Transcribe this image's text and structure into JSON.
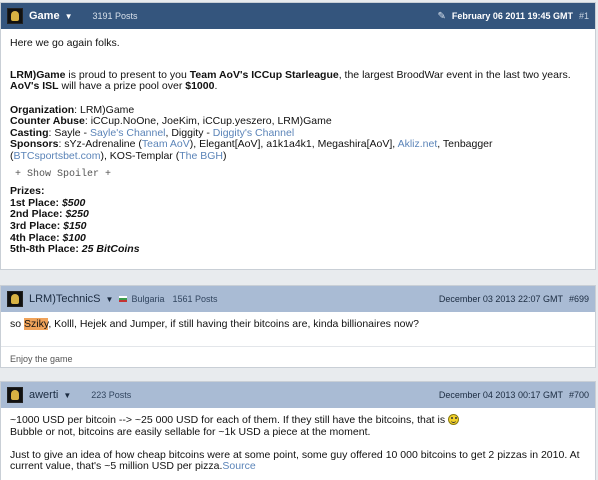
{
  "posts": [
    {
      "user": "Game",
      "post_count": "3191 Posts",
      "date": "February 06 2011 19:45 GMT",
      "num": "#1",
      "intro": "Here we go again folks.",
      "p1_a": "LRM)Game",
      "p1_b": " is proud to present to you ",
      "p1_c": "Team AoV's ICCup Starleague",
      "p1_d": ", the largest BroodWar event in the last two years.",
      "p2_a": "AoV's ISL",
      "p2_b": " will have a prize pool over ",
      "p2_c": "$1000",
      "p2_d": ".",
      "org_label": "Organization",
      "org_value": ": LRM)Game",
      "abuse_label": "Counter Abuse",
      "abuse_value": ": iCCup.NoOne, JoeKim, iCCup.yeszero, LRM)Game",
      "casting_label": "Casting",
      "casting_a": ": Sayle - ",
      "casting_link1": "Sayle's Channel",
      "casting_b": ", Diggity - ",
      "casting_link2": "Diggity's Channel",
      "sponsors_label": "Sponsors",
      "sponsors_a": ": sYz-Adrenaline (",
      "sponsors_link1": "Team AoV",
      "sponsors_b": "), Elegant[AoV], a1k1a4k1, Megashira[AoV], ",
      "sponsors_link2": "Akliz.net",
      "sponsors_c": ", Tenbagger",
      "sponsors_d": "(",
      "sponsors_link3": "BTCsportsbet.com",
      "sponsors_e": "), KOS-Templar (",
      "sponsors_link4": "The BGH",
      "sponsors_f": ")",
      "spoiler": "+ Show Spoiler +",
      "prizes_label": "Prizes",
      "prizes": [
        {
          "place": "1st Place",
          "amount": "$500"
        },
        {
          "place": "2nd Place",
          "amount": "$250"
        },
        {
          "place": "3rd Place",
          "amount": "$150"
        },
        {
          "place": "4th Place",
          "amount": "$100"
        },
        {
          "place": "5th-8th Place",
          "amount": "25 BitCoins"
        }
      ]
    },
    {
      "user": "LRM)TechnicS",
      "country": "Bulgaria",
      "post_count": "1561 Posts",
      "date": "December 03 2013 22:07 GMT",
      "num": "#699",
      "text_a": "so ",
      "text_hl": "Sziky",
      "text_b": ", Kolll, Hejek and Jumper, if still having their bitcoins are, kinda billionaires now?",
      "signature": "Enjoy the game"
    },
    {
      "user": "awerti",
      "post_count": "223 Posts",
      "date": "December 04 2013 00:17 GMT",
      "num": "#700",
      "line1": "~1000 USD per bitcoin --> ~25 000 USD for each of them. If they still have the bitcoins, that is ",
      "line2": "Bubble or not, bitcoins are easily sellable for ~1k USD a piece at the moment.",
      "line3": "Just to give an idea of how cheap bitcoins were at some point, some guy offered 10 000 bitcoins to get 2 pizzas in 2010. At current value, that's ~5 million USD per pizza.",
      "source": "Source"
    }
  ]
}
